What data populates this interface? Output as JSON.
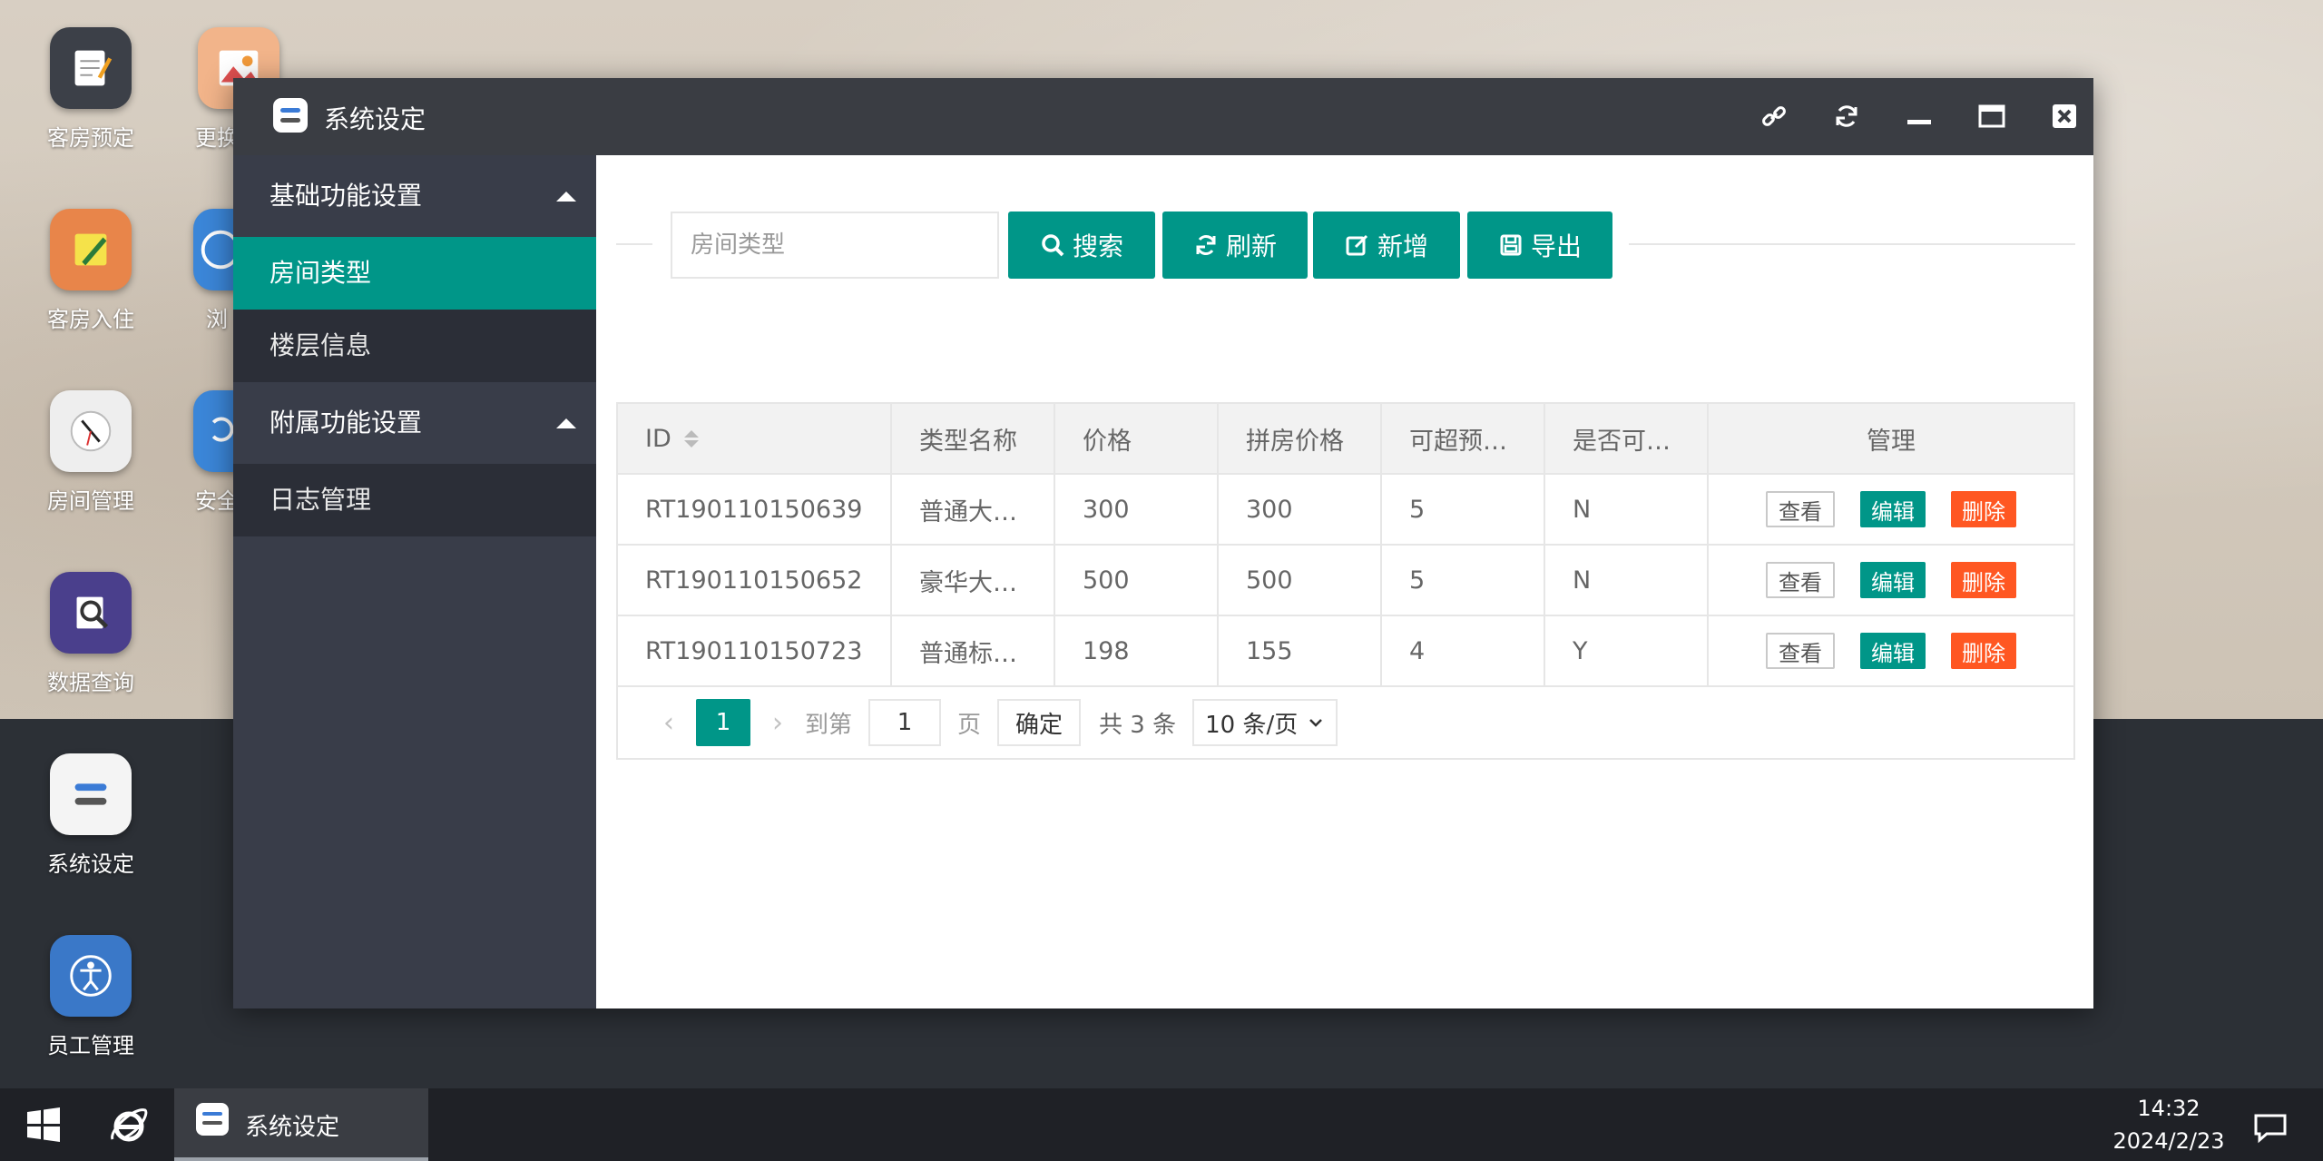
{
  "desktop": {
    "icons": [
      {
        "label": "客房预定",
        "icon": "notepad-icon"
      },
      {
        "label": "更换",
        "icon": "picture-icon"
      },
      {
        "label": "客房入住",
        "icon": "pencil-note-icon"
      },
      {
        "label": "浏",
        "icon": "browser-icon"
      },
      {
        "label": "房间管理",
        "icon": "clock-icon"
      },
      {
        "label": "安全",
        "icon": "security-icon"
      },
      {
        "label": "数据查询",
        "icon": "magnifier-icon"
      },
      {
        "label": "系统设定",
        "icon": "settings-toggle-icon"
      },
      {
        "label": "员工管理",
        "icon": "person-icon"
      }
    ]
  },
  "window": {
    "title": "系统设定",
    "controls": [
      "link-icon",
      "refresh-icon",
      "minimize-icon",
      "maximize-icon",
      "close-icon"
    ]
  },
  "sidebar": {
    "groups": [
      {
        "label": "基础功能设置",
        "items": [
          {
            "label": "房间类型",
            "active": true
          },
          {
            "label": "楼层信息",
            "active": false
          }
        ]
      },
      {
        "label": "附属功能设置",
        "items": [
          {
            "label": "日志管理",
            "active": false
          }
        ]
      }
    ]
  },
  "toolbar": {
    "search_placeholder": "房间类型",
    "search_label": "搜索",
    "refresh_label": "刷新",
    "add_label": "新增",
    "export_label": "导出"
  },
  "table": {
    "headers": [
      "ID",
      "类型名称",
      "价格",
      "拼房价格",
      "可超预…",
      "是否可…",
      "管理"
    ],
    "rows": [
      {
        "id": "RT190110150639",
        "name": "普通大…",
        "price": "300",
        "share_price": "300",
        "over": "5",
        "allow": "N"
      },
      {
        "id": "RT190110150652",
        "name": "豪华大…",
        "price": "500",
        "share_price": "500",
        "over": "5",
        "allow": "N"
      },
      {
        "id": "RT190110150723",
        "name": "普通标…",
        "price": "198",
        "share_price": "155",
        "over": "4",
        "allow": "Y"
      }
    ],
    "actions": {
      "view": "查看",
      "edit": "编辑",
      "delete": "删除"
    }
  },
  "pager": {
    "current": "1",
    "goto_label": "到第",
    "goto_value": "1",
    "page_label": "页",
    "confirm_label": "确定",
    "total_label": "共 3 条",
    "page_size": "10 条/页"
  },
  "taskbar": {
    "app_label": "系统设定",
    "time": "14:32",
    "date": "2024/2/23"
  },
  "colors": {
    "accent": "#009688",
    "danger": "#ff5722",
    "sidebar": "#393d49",
    "titlebar": "#3a3d43"
  }
}
